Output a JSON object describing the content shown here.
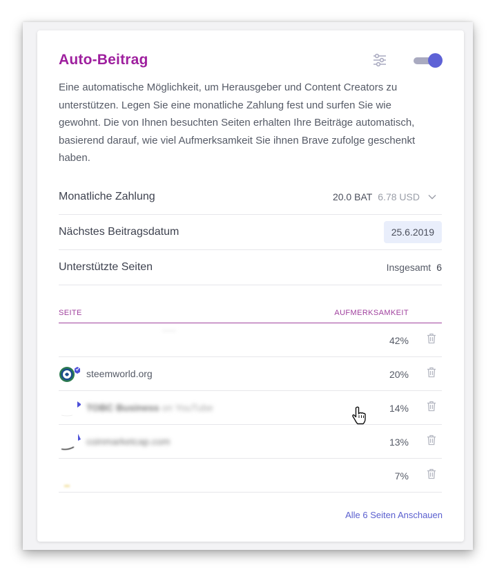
{
  "card": {
    "title": "Auto-Beitrag",
    "description": "Eine automatische Möglichkeit, um Herausgeber und Content Creators zu unterstützen. Legen Sie eine monatliche Zahlung fest und surfen Sie wie gewohnt. Die von Ihnen besuchten Seiten erhalten Ihre Beiträge automatisch, basierend darauf, wie viel Aufmerksamkeit Sie ihnen Brave zufolge geschenkt haben.",
    "toggle_on": true
  },
  "payment": {
    "label": "Monatliche Zahlung",
    "bat": "20.0 BAT",
    "usd": "6.78 USD"
  },
  "next_date": {
    "label": "Nächstes Beitragsdatum",
    "value": "25.6.2019"
  },
  "supported": {
    "label": "Unterstützte Seiten",
    "total_label": "Insgesamt",
    "total": "6"
  },
  "table": {
    "col_site": "SEITE",
    "col_attention": "AUFMERKSAMKEIT",
    "rows": [
      {
        "name": "",
        "percent": "42%"
      },
      {
        "name": "steemworld.org",
        "percent": "20%"
      },
      {
        "name": "TOBC Business",
        "suffix": "on YouTube",
        "percent": "14%"
      },
      {
        "name": "coinmarketcap.com",
        "percent": "13%"
      },
      {
        "name": "",
        "percent": "7%"
      }
    ]
  },
  "see_all": "Alle 6 Seiten Anschauen",
  "colors": {
    "title": "#9e1f9e",
    "accent": "#5e62d6",
    "link": "#5a5fcf",
    "header_line": "#a0419e"
  }
}
